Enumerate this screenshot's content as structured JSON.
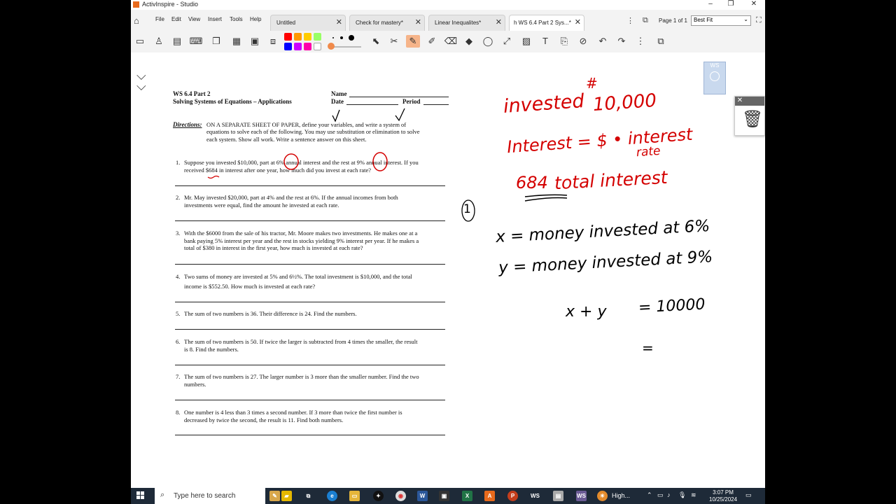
{
  "window": {
    "title": "ActivInspire - Studio"
  },
  "menu": [
    "File",
    "Edit",
    "View",
    "Insert",
    "Tools",
    "Help"
  ],
  "tabs": [
    {
      "label": "Untitled"
    },
    {
      "label": "Check for mastery*"
    },
    {
      "label": "Linear Inequalites*"
    },
    {
      "label": "h WS 6.4 Part 2 Sys...*"
    }
  ],
  "page_indicator": "Page 1 of 1",
  "zoom": "Best Fit",
  "colors": {
    "palette": [
      "#ff0000",
      "#ff9900",
      "#ffcc00",
      "#99ff66",
      "#0000ff",
      "#cc00ff",
      "#ff00aa",
      "#ffffff"
    ],
    "ink_red": "#d40000",
    "ink_black": "#000000",
    "taskbar": "#1e2a38"
  },
  "icons": [
    "home-icon",
    "pointer-icon",
    "pen-icon",
    "highlighter-icon",
    "eraser-icon",
    "fill-icon",
    "shape-icon",
    "connector-icon",
    "text-icon",
    "undo-icon",
    "redo-icon",
    "trash-icon"
  ],
  "worksheet": {
    "title1": "WS 6.4 Part 2",
    "title2": "Solving Systems of Equations – Applications",
    "name_label": "Name",
    "date_label": "Date",
    "period_label": "Period",
    "directions_label": "Directions:",
    "directions_text1": "ON A SEPARATE SHEET OF PAPER, define your variables, and write a system of",
    "directions_text2": "equations to solve each of the following.  You may use substitution or elimination to solve",
    "directions_text3": "each system.  Show all work.  Write a sentence answer on this sheet.",
    "problems": [
      {
        "num": "1.",
        "l1": "Suppose you invested $10,000, part at 6% annual interest and the rest at 9% annual interest.  If you",
        "l2": "received $684 in interest after one year, how much did you invest at each rate?"
      },
      {
        "num": "2.",
        "l1": "Mr. May invested $20,000, part at 4% and the rest at 6%.  If the annual incomes from both",
        "l2": "investments were equal, find the amount he invested at each rate."
      },
      {
        "num": "3.",
        "l1": "With the $6000 from the sale of his tractor, Mr. Moore makes two investments.  He makes one at a",
        "l2": "bank paying 5% interest per year and the rest in stocks yielding 9% interest per year.  If he makes a",
        "l3": "total of $380 in interest in the first year, how much is invested at each rate?"
      },
      {
        "num": "4.",
        "l1": "Two sums of money are invested at 5% and 6½%.  The total investment is $10,000, and the total",
        "l2": "income is $552.50.  How much is invested at each rate?"
      },
      {
        "num": "5.",
        "l1": "The sum of two numbers is 36.  Their difference is 24.  Find the numbers."
      },
      {
        "num": "6.",
        "l1": "The sum of two numbers is 50.  If twice the larger is subtracted from 4 times the smaller, the result",
        "l2": "is 8.  Find the numbers."
      },
      {
        "num": "7.",
        "l1": "The sum of two numbers is 27.  The larger number is 3 more than the smaller number.  Find the two",
        "l2": "numbers."
      },
      {
        "num": "8.",
        "l1": "One number is 4 less than 3 times a second number.  If 3 more than twice the first number is",
        "l2": "decreased by twice the second, the result is 11.  Find both numbers."
      }
    ]
  },
  "handwriting": {
    "red1": "invested",
    "red_hash": "#",
    "red2": "10,000",
    "red3": "Interest = $ • interest",
    "red3b": "rate",
    "red4a": "684",
    "red4b": "total interest",
    "circle1": "1",
    "black1": "x = money invested at 6%",
    "black2": "y = money invested at 9%",
    "black3a": "x + y",
    "black3b": "= 10000",
    "black4": "="
  },
  "side_thumb": "WS",
  "taskbar": {
    "search_placeholder": "Type here to search",
    "weather": "High...",
    "time": "3:07 PM",
    "date": "10/25/2024"
  }
}
